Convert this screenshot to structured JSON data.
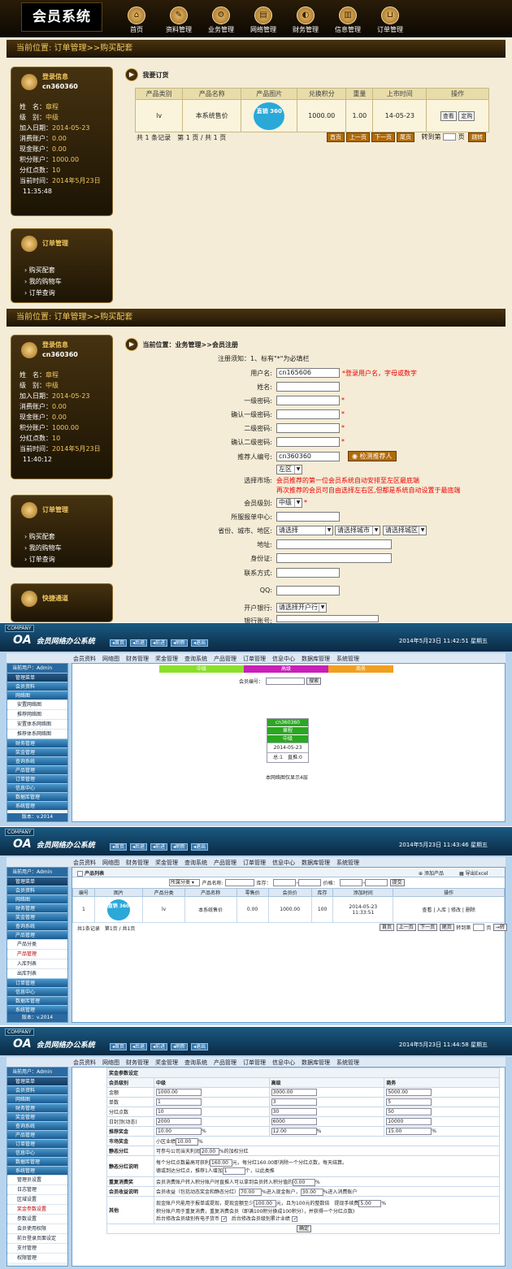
{
  "front": {
    "logo": "会员系统",
    "nav": [
      {
        "label": "首页",
        "icon": "home-icon",
        "glyph": "⌂"
      },
      {
        "label": "资料管理",
        "icon": "pencil-icon",
        "glyph": "✎"
      },
      {
        "label": "业务管理",
        "icon": "gear-icon",
        "glyph": "⚙"
      },
      {
        "label": "网络管理",
        "icon": "document-icon",
        "glyph": "▤"
      },
      {
        "label": "财务管理",
        "icon": "planet-icon",
        "glyph": "◐"
      },
      {
        "label": "信息管理",
        "icon": "chart-icon",
        "glyph": "▥"
      },
      {
        "label": "订单管理",
        "icon": "cart-icon",
        "glyph": "⊔"
      }
    ],
    "page1": {
      "crumb": "当前位置: 订单管理>>购买配套",
      "info_title": "登录信息",
      "username": "cn360360",
      "info_rows": [
        {
          "k": "姓　名：",
          "v": "章程"
        },
        {
          "k": "级　别：",
          "v": "中级"
        },
        {
          "k": "加入日期：",
          "v": "2014-05-23"
        },
        {
          "k": "消费账户：",
          "v": "0.00"
        },
        {
          "k": "现金账户：",
          "v": "0.00"
        },
        {
          "k": "积分账户：",
          "v": "1000.00"
        },
        {
          "k": "分红点数：",
          "v": "10"
        },
        {
          "k": "当前时间：",
          "v": "2014年5月23日"
        }
      ],
      "time2": "11:35:48",
      "order_title": "订单管理",
      "order_links": [
        "购买配套",
        "我的购物车",
        "订单查询"
      ],
      "buy_title": "我要订货",
      "table_headers": [
        "产品类别",
        "产品名称",
        "产品图片",
        "兑换积分",
        "重量",
        "上市时间",
        "操作"
      ],
      "row": {
        "cat": "lv",
        "name": "本系统售价",
        "img_text": "直销 360",
        "points": "1000.00",
        "weight": "1.00",
        "date": "14-05-23",
        "view": "查看",
        "order": "定购"
      },
      "summary": "共 1 条记录　第 1 页 / 共 1 页",
      "pager": [
        "首页",
        "上一页",
        "下一页",
        "尾页"
      ],
      "goto_label": "转到第",
      "goto_suffix": "页",
      "goto_btn": "跳转"
    },
    "page2": {
      "crumb": "当前位置: 订单管理>>购买配套",
      "info_title": "登录信息",
      "username": "cn360360",
      "info_rows": [
        {
          "k": "姓　名：",
          "v": "章程"
        },
        {
          "k": "级　别：",
          "v": "中级"
        },
        {
          "k": "加入日期：",
          "v": "2014-05-23"
        },
        {
          "k": "消费账户：",
          "v": "0.00"
        },
        {
          "k": "现金账户：",
          "v": "0.00"
        },
        {
          "k": "积分账户：",
          "v": "1000.00"
        },
        {
          "k": "分红点数：",
          "v": "10"
        },
        {
          "k": "当前时间：",
          "v": "2014年5月23日"
        }
      ],
      "time2": "11:40:12",
      "order_title": "订单管理",
      "order_links": [
        "购买配套",
        "我的购物车",
        "订单查询"
      ],
      "quick_title": "快捷通道",
      "reg_title": "当前位置：业务管理>>会员注册",
      "notice": "注册须知：1、标有\"*\"为必填栏",
      "labels": {
        "username": "用户名:",
        "name": "姓名:",
        "pwd1": "一级密码:",
        "pwd1c": "确认一级密码:",
        "pwd2": "二级密码:",
        "pwd2c": "确认二级密码:",
        "referrer": "推荐人编号:",
        "market": "选择市场:",
        "level": "会员级别:",
        "center": "所服报单中心:",
        "region": "省份、城市、地区:",
        "address": "地址:",
        "idcard": "身份证:",
        "contact": "联系方式:",
        "qq": "QQ:",
        "bank": "开户银行:",
        "account": "银行账号:"
      },
      "username_val": "cn165606",
      "username_hint": "*登录用户名，字母或数字",
      "referrer_val": "cn360360",
      "check_btn": "检测推荐人",
      "market_val": "左区",
      "market_hint1": "会员推荐的第一位会员系统自动安排至左区最底端",
      "market_hint2": "再次推荐的会员可自由选择左右区,但都是系统自动设置于最底端",
      "level_val": "中级",
      "prov": "请选择",
      "city": "请选择城市",
      "dist": "请选择城区",
      "bank_val": "请选择开户行"
    }
  },
  "admin": {
    "company": "COMPANY",
    "logo_mark": "OA",
    "logo": "会员网络办公系统",
    "toolbar": [
      "首页",
      "后退",
      "前进",
      "刷新",
      "退出"
    ],
    "menu": [
      "会员资料",
      "网络图",
      "财务管理",
      "奖金管理",
      "查询系统",
      "产品管理",
      "订单管理",
      "信息中心",
      "数据库管理",
      "系统管理"
    ],
    "current_user": "当前用户：Admin",
    "version": "版本：v.2014",
    "s1": {
      "time": "2014年5月23日 11:42:51 星期五",
      "side": [
        {
          "t": "mh top",
          "l": "管理菜单"
        },
        {
          "t": "mh",
          "l": "会员资料"
        },
        {
          "t": "mh",
          "l": "网络图"
        },
        {
          "t": "si",
          "l": "安置网络图"
        },
        {
          "t": "si",
          "l": "推荐网络图"
        },
        {
          "t": "si",
          "l": "安置体系网络图"
        },
        {
          "t": "si",
          "l": "推荐体系网络图"
        },
        {
          "t": "mh",
          "l": "财务管理"
        },
        {
          "t": "mh",
          "l": "奖金管理"
        },
        {
          "t": "mh",
          "l": "查询系统"
        },
        {
          "t": "mh",
          "l": "产品管理"
        },
        {
          "t": "mh",
          "l": "订单管理"
        },
        {
          "t": "mh",
          "l": "信息中心"
        },
        {
          "t": "mh",
          "l": "数据库管理"
        },
        {
          "t": "mh",
          "l": "系统管理"
        }
      ],
      "levels": [
        "中级",
        "高级",
        "商务"
      ],
      "member_label": "会员编号：",
      "search_btn": "搜索",
      "node": {
        "id": "cn360360",
        "name": "章程",
        "level": "中级",
        "date": "2014-05-23",
        "total": "总:1",
        "direct": "直推:0"
      },
      "foot": "本网络图仅显示4层"
    },
    "s2": {
      "time": "2014年5月23日 11:43:46 星期五",
      "side": [
        {
          "t": "mh top",
          "l": "管理菜单"
        },
        {
          "t": "mh",
          "l": "会员资料"
        },
        {
          "t": "mh",
          "l": "网络图"
        },
        {
          "t": "mh",
          "l": "财务管理"
        },
        {
          "t": "mh",
          "l": "奖金管理"
        },
        {
          "t": "mh",
          "l": "查询系统"
        },
        {
          "t": "mh",
          "l": "产品管理"
        },
        {
          "t": "si",
          "l": "产品分类"
        },
        {
          "t": "si on",
          "l": "产品管理"
        },
        {
          "t": "si",
          "l": "入库列表"
        },
        {
          "t": "si",
          "l": "出库列表"
        },
        {
          "t": "mh",
          "l": "订单管理"
        },
        {
          "t": "mh",
          "l": "信息中心"
        },
        {
          "t": "mh",
          "l": "数据库管理"
        },
        {
          "t": "mh",
          "l": "系统管理"
        }
      ],
      "list_title": "产品列表",
      "add": "添加产品",
      "export": "导出Excel",
      "cat_sel": "所属分类",
      "f_name": "产品名称:",
      "f_stock": "库存：",
      "f_price": "价格：",
      "submit": "提交",
      "headers": [
        "编号",
        "图片",
        "产品分类",
        "产品名称",
        "零售价",
        "会员价",
        "库存",
        "添加时间",
        "操作"
      ],
      "row": {
        "no": "1",
        "cat": "lv",
        "name": "本系统售价",
        "retail": "0.00",
        "member": "1000.00",
        "stock": "100",
        "date": "2014-05-23",
        "time": "11:33:51",
        "ops": "查看 | 入库 | 修改 | 删除"
      },
      "summary": "共1条记录　第1页 / 共1页",
      "pager": [
        "首页",
        "上一页",
        "下一页",
        "尾页"
      ],
      "goto": "转到第",
      "goto_suffix": "页",
      "goto_btn": "→转"
    },
    "s3": {
      "time": "2014年5月23日 11:44:58 星期五",
      "side": [
        {
          "t": "cu",
          "l": "当前用户：Admin"
        },
        {
          "t": "mh top",
          "l": "管理菜单"
        },
        {
          "t": "mh",
          "l": "会员资料"
        },
        {
          "t": "mh",
          "l": "网络图"
        },
        {
          "t": "mh",
          "l": "财务管理"
        },
        {
          "t": "mh",
          "l": "奖金管理"
        },
        {
          "t": "mh",
          "l": "查询系统"
        },
        {
          "t": "mh",
          "l": "产品管理"
        },
        {
          "t": "mh",
          "l": "订单管理"
        },
        {
          "t": "mh",
          "l": "信息中心"
        },
        {
          "t": "mh",
          "l": "数据库管理"
        },
        {
          "t": "mh",
          "l": "系统管理"
        },
        {
          "t": "si",
          "l": "管理员设置"
        },
        {
          "t": "si",
          "l": "日志管理"
        },
        {
          "t": "si",
          "l": "区域设置"
        },
        {
          "t": "si on",
          "l": "奖金参数设置"
        },
        {
          "t": "si",
          "l": "参数设置"
        },
        {
          "t": "si",
          "l": "会员使用权限"
        },
        {
          "t": "si",
          "l": "前台登录页面设定"
        },
        {
          "t": "si",
          "l": "支付管理"
        },
        {
          "t": "si",
          "l": "权限管理"
        }
      ],
      "title": "奖金参数设定",
      "cols": [
        "会员级别",
        "中级",
        "高级",
        "商务"
      ],
      "rows": [
        {
          "k": "金额",
          "v": [
            "1000.00",
            "3000.00",
            "5000.00"
          ],
          "u": ""
        },
        {
          "k": "单数",
          "v": [
            "1",
            "3",
            "5"
          ],
          "u": ""
        },
        {
          "k": "分红点数",
          "v": [
            "10",
            "30",
            "50"
          ],
          "u": ""
        },
        {
          "k": "日封顶(动态)",
          "v": [
            "2000",
            "6000",
            "10000"
          ],
          "u": ""
        },
        {
          "k": "推荐奖金",
          "v": [
            "10.00",
            "12.00",
            "15.00"
          ],
          "u": "%"
        }
      ],
      "market_k": "市场奖金",
      "market_t": "小区业绩",
      "market_v": "10.00",
      "static_k": "静态分红",
      "static_t1": "可参与公司当天利润",
      "static_v": "20.00",
      "static_t2": "%的加权分红",
      "sdesc_k": "静态分红说明",
      "sdesc_t1": "每个分红点数最高可获利",
      "sdesc_v": "160.00",
      "sdesc_t2": "元，每分红160.00即消除一个分红点数，每天结算。",
      "sdesc_t3": "德或到达分红点，推荐1人增加",
      "sdesc_v2": "1",
      "sdesc_t4": "个，以此类推",
      "repeat_k": "重复消费奖",
      "repeat_t": "会员消费账户转入积分账户时直推人可以拿到会员转入积分值的",
      "repeat_v": "0.00",
      "income_k": "会员收益说明",
      "income_t1": "会员收益（包括动态奖金和静态分红）",
      "income_v1": "70.00",
      "income_t2": "%进入现金账户，",
      "income_v2": "30.00",
      "income_t3": "%进入消费账户",
      "other_k": "其他",
      "other_t1": "现金账户只能用于报单或提现，提现金额至少",
      "other_v1": "100.00",
      "other_t2": "元，且为100元的整数倍　提现手续费",
      "other_v2": "5.00",
      "other_t3": "积分账户用于重复消费，重复消费会员（即满100积分换成100积分），并获得一个分红点数)",
      "other_t4": "后台修改会员级别有电子货币",
      "other_t5": "后台修改会员级别累计业绩",
      "ok": "确定"
    }
  }
}
